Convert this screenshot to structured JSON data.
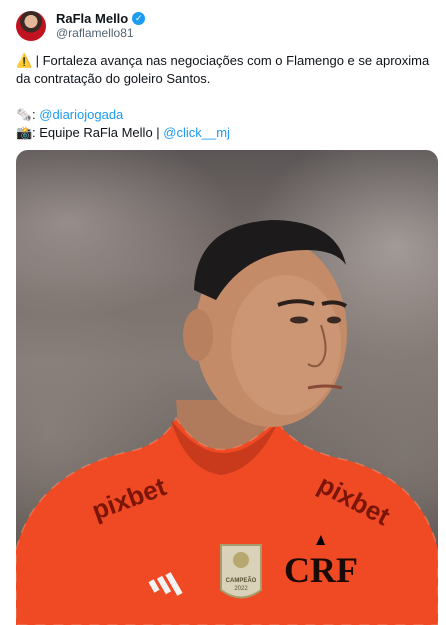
{
  "user": {
    "display_name": "RaFla Mello",
    "handle": "@raflamello81",
    "verified_icon": "verified-check-icon"
  },
  "tweet": {
    "line1_emoji": "⚠️",
    "line1_text": "| Fortaleza avança nas negociações com o Flamengo e se aproxima",
    "line2_text": "da contratação do goleiro Santos.",
    "source_emoji": "🗞️",
    "source_prefix": ":",
    "source_link": "@diariojogada",
    "photo_emoji": "📸",
    "photo_prefix": ": Equipe RaFla Mello |",
    "photo_link": "@click__mj"
  },
  "media": {
    "jersey_sponsor_left": "pixbet",
    "jersey_sponsor_right": "pixbet",
    "badge_text": "CAMPEÃO",
    "badge_year": "2022",
    "brand_logo": "adidas-logo",
    "club_crest": "CRF"
  },
  "colors": {
    "link": "#1d9bf0",
    "jersey": "#ef4a23",
    "text": "#0f1419",
    "secondary_text": "#536471"
  }
}
